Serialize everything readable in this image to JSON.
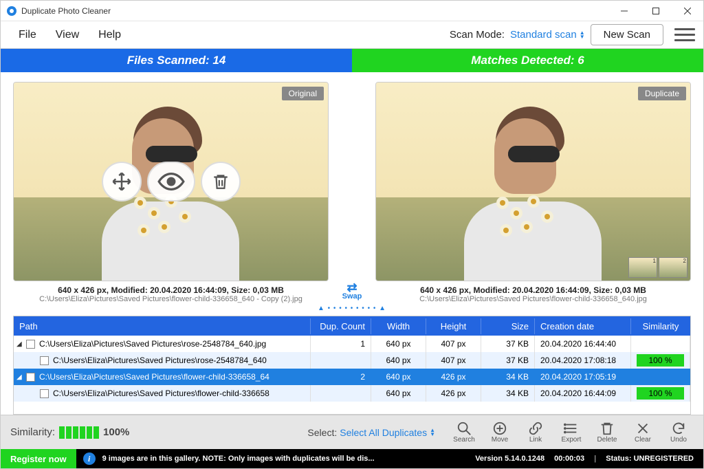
{
  "titlebar": {
    "title": "Duplicate Photo Cleaner"
  },
  "menu": {
    "file": "File",
    "view": "View",
    "help": "Help"
  },
  "scanmode": {
    "label": "Scan Mode:",
    "value": "Standard scan"
  },
  "newscan": "New Scan",
  "stats": {
    "files_label": "Files Scanned: 14",
    "matches_label": "Matches Detected: 6"
  },
  "preview": {
    "left": {
      "badge": "Original",
      "meta": "640 x 426 px, Modified: 20.04.2020 16:44:09, Size: 0,03 MB",
      "path": "C:\\Users\\Eliza\\Pictures\\Saved Pictures\\flower-child-336658_640 - Copy (2).jpg"
    },
    "right": {
      "badge": "Duplicate",
      "meta": "640 x 426 px, Modified: 20.04.2020 16:44:09, Size: 0,03 MB",
      "path": "C:\\Users\\Eliza\\Pictures\\Saved Pictures\\flower-child-336658_640.jpg"
    },
    "swap": "Swap"
  },
  "table": {
    "headers": {
      "path": "Path",
      "dup": "Dup. Count",
      "width": "Width",
      "height": "Height",
      "size": "Size",
      "date": "Creation date",
      "sim": "Similarity"
    },
    "rows": [
      {
        "type": "group",
        "path": "C:\\Users\\Eliza\\Pictures\\Saved Pictures\\rose-2548784_640.jpg",
        "dup": "1",
        "width": "640 px",
        "height": "407 px",
        "size": "37 KB",
        "date": "20.04.2020 16:44:40",
        "sim": ""
      },
      {
        "type": "child",
        "path": "C:\\Users\\Eliza\\Pictures\\Saved Pictures\\rose-2548784_640",
        "dup": "",
        "width": "640 px",
        "height": "407 px",
        "size": "37 KB",
        "date": "20.04.2020 17:08:18",
        "sim": "100 %"
      },
      {
        "type": "group-sel",
        "path": "C:\\Users\\Eliza\\Pictures\\Saved Pictures\\flower-child-336658_64",
        "dup": "2",
        "width": "640 px",
        "height": "426 px",
        "size": "34 KB",
        "date": "20.04.2020 17:05:19",
        "sim": ""
      },
      {
        "type": "child",
        "path": "C:\\Users\\Eliza\\Pictures\\Saved Pictures\\flower-child-336658",
        "dup": "",
        "width": "640 px",
        "height": "426 px",
        "size": "34 KB",
        "date": "20.04.2020 16:44:09",
        "sim": "100 %"
      }
    ]
  },
  "similarity": {
    "label": "Similarity:",
    "percent": "100%"
  },
  "select": {
    "label": "Select:",
    "value": "Select All Duplicates"
  },
  "actions": {
    "search": "Search",
    "move": "Move",
    "link": "Link",
    "export": "Export",
    "delete": "Delete",
    "clear": "Clear",
    "undo": "Undo"
  },
  "status": {
    "register": "Register now",
    "message": "9 images are in this gallery. NOTE: Only images with duplicates will be dis...",
    "version": "Version 5.14.0.1248",
    "timer": "00:00:03",
    "reg": "Status: UNREGISTERED"
  }
}
